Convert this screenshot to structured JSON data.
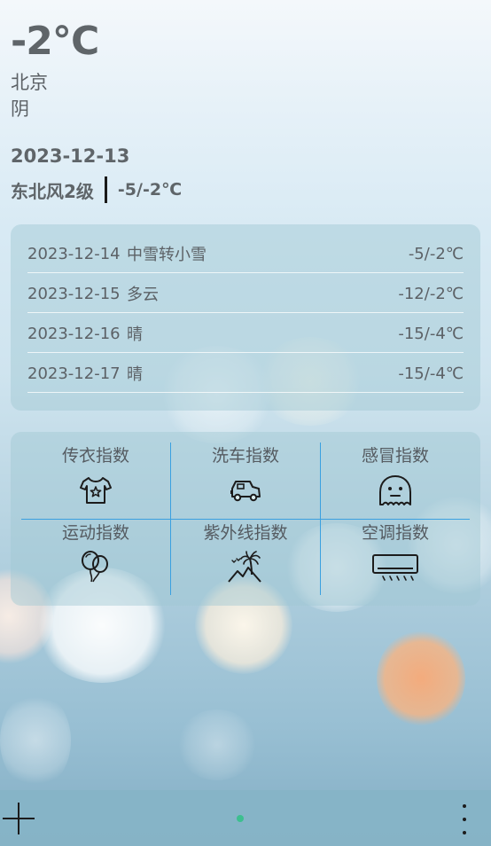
{
  "current": {
    "temperature": "-2℃",
    "city": "北京",
    "condition": "阴",
    "date": "2023-12-13",
    "wind": "东北风2级",
    "range": "-5/-2℃"
  },
  "forecast": [
    {
      "date": "2023-12-14",
      "condition": "中雪转小雪",
      "range": "-5/-2℃"
    },
    {
      "date": "2023-12-15",
      "condition": "多云",
      "range": "-12/-2℃"
    },
    {
      "date": "2023-12-16",
      "condition": "晴",
      "range": "-15/-4℃"
    },
    {
      "date": "2023-12-17",
      "condition": "晴",
      "range": "-15/-4℃"
    }
  ],
  "indices": [
    {
      "label": "传衣指数",
      "icon": "tshirt-icon"
    },
    {
      "label": "洗车指数",
      "icon": "car-icon"
    },
    {
      "label": "感冒指数",
      "icon": "ghost-icon"
    },
    {
      "label": "运动指数",
      "icon": "balloons-icon"
    },
    {
      "label": "紫外线指数",
      "icon": "palm-island-icon"
    },
    {
      "label": "空调指数",
      "icon": "air-conditioner-icon"
    }
  ],
  "bottom_bar": {
    "add_icon": "plus-icon",
    "more_icon": "vertical-dots-icon",
    "page_indicator_color": "#3dbf8f"
  },
  "colors": {
    "grid_line": "#3aa0e0",
    "text": "#5c6166"
  }
}
